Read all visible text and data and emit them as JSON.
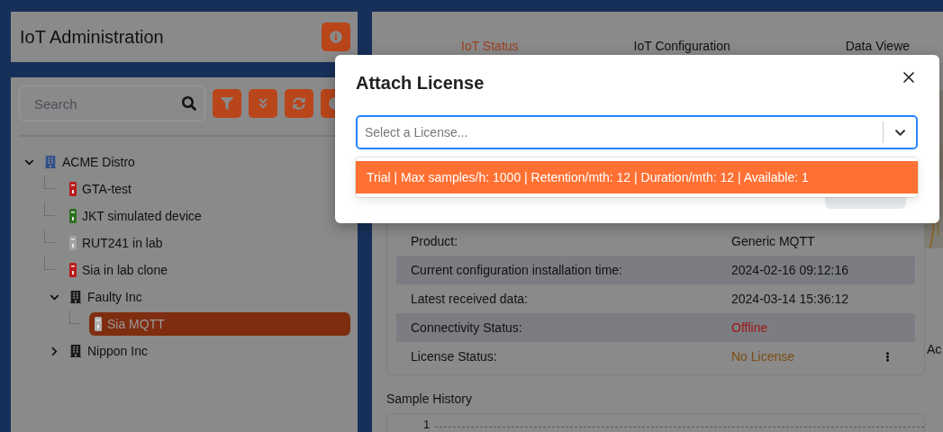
{
  "sidebar": {
    "title": "IoT Administration",
    "search": {
      "placeholder": "Search"
    },
    "tree": [
      {
        "label": "ACME Distro",
        "kind": "org",
        "expanded": true,
        "selected": false,
        "children": [
          {
            "label": "GTA-test",
            "kind": "device",
            "color": "#b81c1c",
            "selected": false
          },
          {
            "label": "JKT simulated device",
            "kind": "device",
            "color": "#2d7020",
            "selected": false
          },
          {
            "label": "RUT241 in lab",
            "kind": "device",
            "color": "#a2a2a2",
            "selected": false
          },
          {
            "label": "Sia in lab clone",
            "kind": "device",
            "color": "#b81c1c",
            "selected": false
          },
          {
            "label": "Faulty Inc",
            "kind": "org",
            "expanded": true,
            "selected": false,
            "children": [
              {
                "label": "Sia MQTT",
                "kind": "device",
                "color": "#b0b0b0",
                "selected": true
              }
            ]
          },
          {
            "label": "Nippon Inc",
            "kind": "org",
            "expanded": false,
            "selected": false
          }
        ]
      }
    ]
  },
  "tabs": [
    {
      "label": "IoT Status",
      "selected": true
    },
    {
      "label": "IoT Configuration",
      "selected": false
    },
    {
      "label": "Data Viewe",
      "selected": false
    }
  ],
  "details": [
    {
      "label": "Product:",
      "value": "Generic MQTT"
    },
    {
      "label": "Current configuration installation time:",
      "value": "2024-02-16 09:12:16"
    },
    {
      "label": "Latest received data:",
      "value": "2024-03-14 15:36:12"
    },
    {
      "label": "Connectivity Status:",
      "value": "Offline",
      "color": "#a01818"
    },
    {
      "label": "License Status:",
      "value": "No License",
      "color": "#7c4c12",
      "menu": true
    }
  ],
  "sample_history": {
    "title": "Sample History",
    "tick": "1"
  },
  "side": {
    "heading": "Ac"
  },
  "dialog": {
    "title": "Attach License",
    "select": {
      "placeholder": "Select a License..."
    },
    "options": [
      {
        "label": "Trial | Max samples/h: 1000 | Retention/mth: 12 | Duration/mth: 12 | Available: 1",
        "selected": true
      }
    ]
  }
}
